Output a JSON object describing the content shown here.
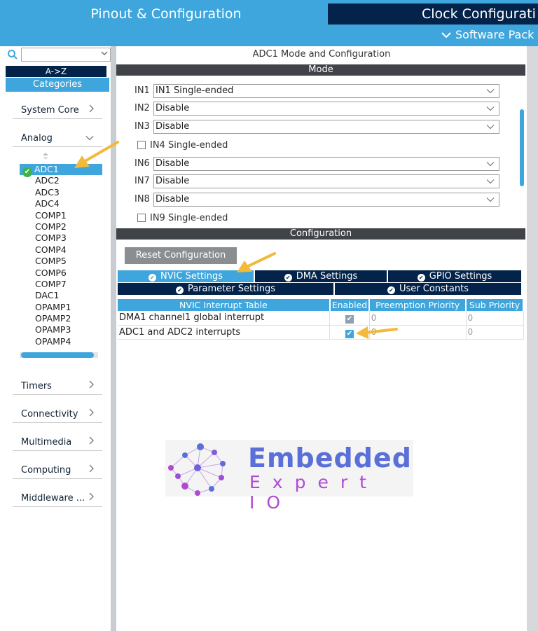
{
  "header": {
    "tab_pinout": "Pinout & Configuration",
    "tab_clock": "Clock Configurati",
    "software_packs": "Software Pack"
  },
  "sidebar": {
    "search_value": "",
    "sort_az": "A->Z",
    "sort_categories": "Categories",
    "categories": {
      "system_core": "System Core",
      "analog": "Analog",
      "timers": "Timers",
      "connectivity": "Connectivity",
      "multimedia": "Multimedia",
      "computing": "Computing",
      "middleware": "Middleware ..."
    },
    "peripherals": [
      "ADC1",
      "ADC2",
      "ADC3",
      "ADC4",
      "COMP1",
      "COMP2",
      "COMP3",
      "COMP4",
      "COMP5",
      "COMP6",
      "COMP7",
      "DAC1",
      "OPAMP1",
      "OPAMP2",
      "OPAMP3",
      "OPAMP4"
    ],
    "selected_peripheral": "ADC1"
  },
  "main": {
    "panel_title": "ADC1 Mode and Configuration",
    "mode_bar": "Mode",
    "mode_rows": [
      {
        "label": "IN1",
        "value": "IN1 Single-ended"
      },
      {
        "label": "IN2",
        "value": "Disable"
      },
      {
        "label": "IN3",
        "value": "Disable"
      },
      {
        "label": "IN6",
        "value": "Disable"
      },
      {
        "label": "IN7",
        "value": "Disable"
      },
      {
        "label": "IN8",
        "value": "Disable"
      }
    ],
    "mode_checks": [
      "IN4 Single-ended",
      "IN9 Single-ended"
    ],
    "config_bar": "Configuration",
    "reset_button": "Reset Configuration",
    "tabs": {
      "nvic": "NVIC Settings",
      "dma": "DMA Settings",
      "gpio": "GPIO Settings",
      "parameter": "Parameter Settings",
      "user_constants": "User Constants"
    },
    "table": {
      "headers": [
        "NVIC Interrupt Table",
        "Enabled",
        "Preemption Priority",
        "Sub Priority"
      ],
      "rows": [
        {
          "name": "DMA1 channel1 global interrupt",
          "enabled": true,
          "preemption": "0",
          "sub": "0"
        },
        {
          "name": "ADC1 and ADC2 interrupts",
          "enabled": true,
          "preemption": "0",
          "sub": "0"
        }
      ]
    }
  },
  "watermark": {
    "line1": "Embedded",
    "line2": "Expert IO"
  },
  "colors": {
    "accent": "#3ea6dc",
    "navy": "#03234b",
    "bar_dark": "#404347",
    "annotation_arrow": "#f2b93b"
  }
}
